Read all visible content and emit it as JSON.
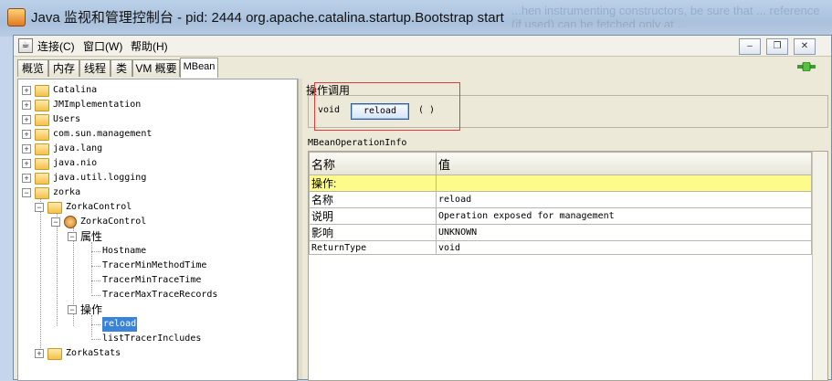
{
  "window": {
    "title": "Java 监视和管理控制台 - pid: 2444 org.apache.catalina.startup.Bootstrap start",
    "ghost_text": "...hen instrumenting constructors, be sure that ... reference (if used) can be fetched only at ..."
  },
  "menu": [
    "连接(C)",
    "窗口(W)",
    "帮助(H)"
  ],
  "window_buttons": [
    "–",
    "❐",
    "✕"
  ],
  "tabs": [
    "概览",
    "内存",
    "线程",
    "类",
    "VM 概要",
    "MBean"
  ],
  "tree": {
    "nodes": [
      {
        "label": "Catalina"
      },
      {
        "label": "JMImplementation"
      },
      {
        "label": "Users"
      },
      {
        "label": "com.sun.management"
      },
      {
        "label": "java.lang"
      },
      {
        "label": "java.nio"
      },
      {
        "label": "java.util.logging"
      },
      {
        "label": "zorka"
      },
      {
        "label": "ZorkaControl"
      },
      {
        "label": "ZorkaControl"
      },
      {
        "label": "属性"
      },
      {
        "label": "Hostname"
      },
      {
        "label": "TracerMinMethodTime"
      },
      {
        "label": "TracerMinTraceTime"
      },
      {
        "label": "TracerMaxTraceRecords"
      },
      {
        "label": "操作"
      },
      {
        "label": "reload"
      },
      {
        "label": "listTracerIncludes"
      },
      {
        "label": "ZorkaStats"
      }
    ]
  },
  "operation": {
    "header": "操作调用",
    "return_type": "void",
    "button_label": "reload",
    "params": "( )"
  },
  "info": {
    "header": "MBeanOperationInfo",
    "columns": [
      "名称",
      "值"
    ],
    "rows": [
      {
        "name": "操作:",
        "value": ""
      },
      {
        "name": "名称",
        "value": "reload"
      },
      {
        "name": "说明",
        "value": "Operation exposed for management"
      },
      {
        "name": "影响",
        "value": "UNKNOWN"
      },
      {
        "name": "ReturnType",
        "value": "void"
      }
    ]
  },
  "colors": {
    "selection": "#3a83d6",
    "highlight_row": "#fdfc8a",
    "callout": "#e33b3b"
  }
}
